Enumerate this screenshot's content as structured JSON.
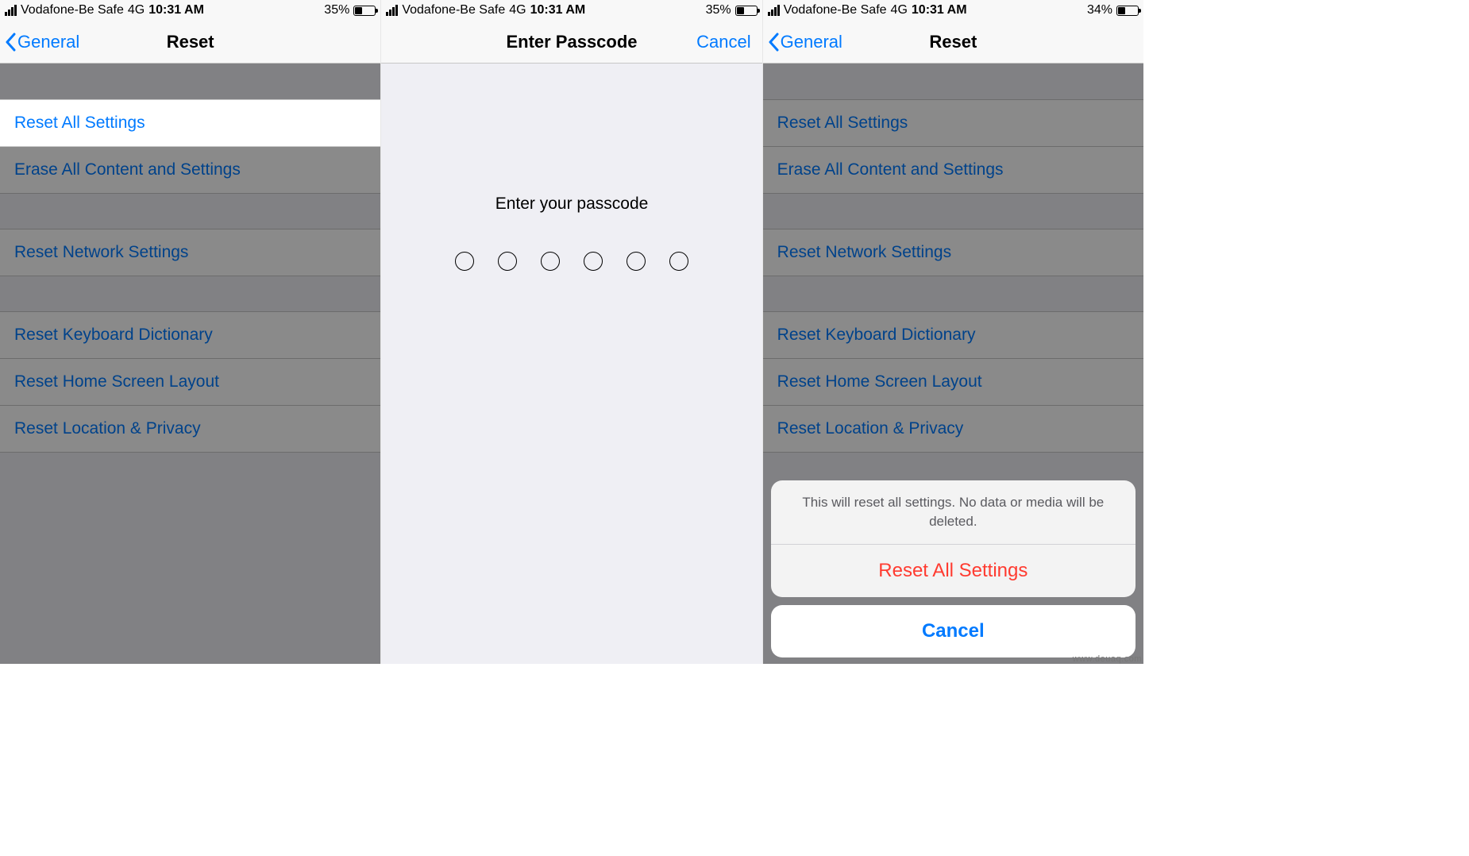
{
  "screens": {
    "left": {
      "status": {
        "carrier": "Vodafone-Be Safe",
        "network": "4G",
        "time": "10:31 AM",
        "battery_pct": "35%"
      },
      "nav": {
        "back_label": "General",
        "title": "Reset"
      },
      "items": {
        "reset_all": "Reset All Settings",
        "erase_all": "Erase All Content and Settings",
        "reset_network": "Reset Network Settings",
        "reset_keyboard": "Reset Keyboard Dictionary",
        "reset_home": "Reset Home Screen Layout",
        "reset_location": "Reset Location & Privacy"
      }
    },
    "middle": {
      "status": {
        "carrier": "Vodafone-Be Safe",
        "network": "4G",
        "time": "10:31 AM",
        "battery_pct": "35%"
      },
      "nav": {
        "title": "Enter Passcode",
        "cancel": "Cancel"
      },
      "prompt": "Enter your passcode",
      "passcode_length": 6
    },
    "right": {
      "status": {
        "carrier": "Vodafone-Be Safe",
        "network": "4G",
        "time": "10:31 AM",
        "battery_pct": "34%"
      },
      "nav": {
        "back_label": "General",
        "title": "Reset"
      },
      "items": {
        "reset_all": "Reset All Settings",
        "erase_all": "Erase All Content and Settings",
        "reset_network": "Reset Network Settings",
        "reset_keyboard": "Reset Keyboard Dictionary",
        "reset_home": "Reset Home Screen Layout",
        "reset_location": "Reset Location & Privacy"
      },
      "sheet": {
        "message": "This will reset all settings. No data or media will be deleted.",
        "action": "Reset All Settings",
        "cancel": "Cancel"
      }
    }
  },
  "watermark": "www.deuaq.com"
}
